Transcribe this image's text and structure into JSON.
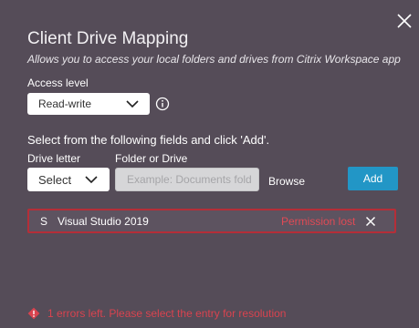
{
  "dialog": {
    "title": "Client Drive Mapping",
    "subtitle": "Allows you to access your local folders and drives from Citrix Workspace app",
    "close_icon": "close-icon"
  },
  "access": {
    "label": "Access level",
    "selected": "Read-write",
    "info_icon": "info-icon"
  },
  "form": {
    "instruction": "Select from the following fields and click 'Add'.",
    "drive_letter_label": "Drive letter",
    "drive_letter_value": "Select",
    "folder_label": "Folder or Drive",
    "folder_placeholder": "Example: Documents folder",
    "browse_label": "Browse",
    "add_label": "Add"
  },
  "entries": [
    {
      "letter": "S",
      "path": "Visual Studio 2019",
      "status": "Permission lost"
    }
  ],
  "error": {
    "message": "1 errors left. Please select the entry for resolution"
  },
  "colors": {
    "background": "#554c58",
    "accent": "#2296c6",
    "error": "#d9434f"
  }
}
